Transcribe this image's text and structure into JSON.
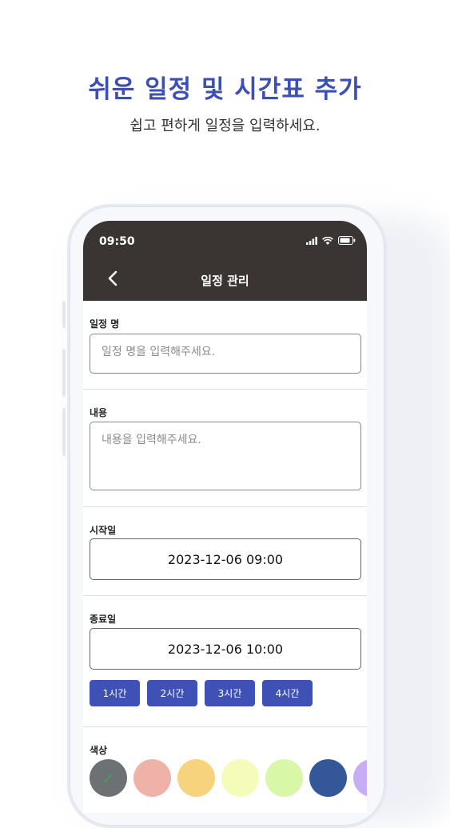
{
  "promo": {
    "title": "쉬운 일정 및 시간표 추가",
    "subtitle": "쉽고 편하게 일정을 입력하세요."
  },
  "status": {
    "time": "09:50"
  },
  "appbar": {
    "title": "일정 관리",
    "back_icon": "chevron-left-icon"
  },
  "form": {
    "name_label": "일정 명",
    "name_placeholder": "일정 명을 입력해주세요.",
    "content_label": "내용",
    "content_placeholder": "내용을 입력해주세요.",
    "start_label": "시작일",
    "start_value": "2023-12-06 09:00",
    "end_label": "종료일",
    "end_value": "2023-12-06 10:00",
    "quick_durations": [
      "1시간",
      "2시간",
      "3시간",
      "4시간"
    ],
    "color_label": "색상",
    "colors": [
      "#6e7174",
      "#eeb2a9",
      "#f6d37c",
      "#f5fbb9",
      "#d8f8a8",
      "#34579a",
      "#c7adf3"
    ],
    "selected_color_index": 0
  }
}
